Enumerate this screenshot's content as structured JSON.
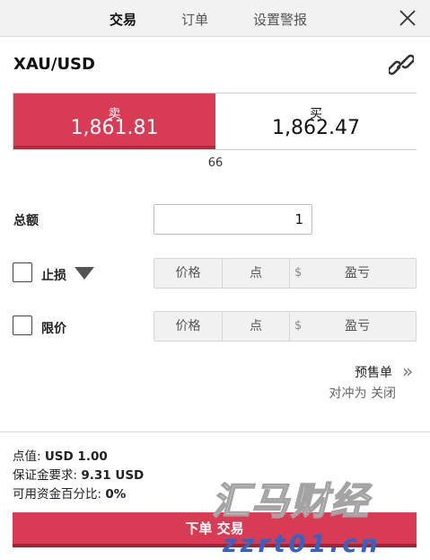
{
  "tabs": [
    {
      "label": "交易",
      "active": true
    },
    {
      "label": "订单",
      "active": false
    },
    {
      "label": "设置警报",
      "active": false
    }
  ],
  "instrument": {
    "symbol": "XAU/USD"
  },
  "quote": {
    "sell_label": "卖",
    "sell_price": "1,861.81",
    "buy_label": "买",
    "buy_price": "1,862.47",
    "spread": "66"
  },
  "form": {
    "amount_label": "总额",
    "amount_value": "1",
    "stop_loss_label": "止损",
    "limit_label": "限价",
    "price_placeholder": "价格",
    "points_placeholder": "点",
    "currency_symbol": "$",
    "pnl_placeholder": "盈亏"
  },
  "pre_order": {
    "label": "预售单",
    "hedge_text": "对冲为 关闭"
  },
  "info": {
    "pip_value_label": "点值: ",
    "pip_value": "USD 1.00",
    "margin_label": "保证金要求: ",
    "margin_value": "9.31 USD",
    "available_label": "可用资金百分比: ",
    "available_value": "0%"
  },
  "submit": {
    "label": "下单 交易"
  },
  "watermark": {
    "text_cn": "汇马财经",
    "text_url": "zzrt01.cn"
  },
  "colors": {
    "sell": "#d93b55",
    "submit": "#d93b55",
    "watermark_url": "#2f65c4"
  }
}
